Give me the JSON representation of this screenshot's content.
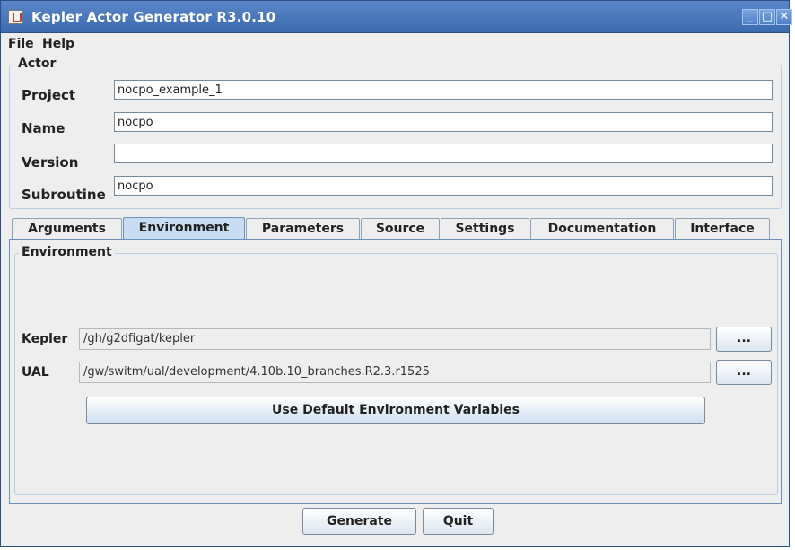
{
  "window": {
    "title": "Kepler Actor Generator R3.0.10"
  },
  "menu": {
    "file": "File",
    "help": "Help"
  },
  "actor": {
    "group_title": "Actor",
    "project_label": "Project",
    "project_value": "nocpo_example_1",
    "name_label": "Name",
    "name_value": "nocpo",
    "version_label": "Version",
    "version_value": "",
    "subroutine_label": "Subroutine",
    "subroutine_value": "nocpo"
  },
  "tabs": [
    {
      "label": "Arguments"
    },
    {
      "label": "Environment"
    },
    {
      "label": "Parameters"
    },
    {
      "label": "Source"
    },
    {
      "label": "Settings"
    },
    {
      "label": "Documentation"
    },
    {
      "label": "Interface"
    }
  ],
  "active_tab": "Environment",
  "environment": {
    "group_title": "Environment",
    "kepler_label": "Kepler",
    "kepler_path": "/gh/g2dfigat/kepler",
    "ual_label": "UAL",
    "ual_path": "/gw/switm/ual/development/4.10b.10_branches.R2.3.r1525",
    "browse_label": "...",
    "default_button": "Use Default Environment Variables"
  },
  "footer": {
    "generate": "Generate",
    "quit": "Quit"
  },
  "colors": {
    "titlebar": "#3c6aaf",
    "active_tab": "#c8dcf3",
    "panel_border": "#6d90b8"
  }
}
